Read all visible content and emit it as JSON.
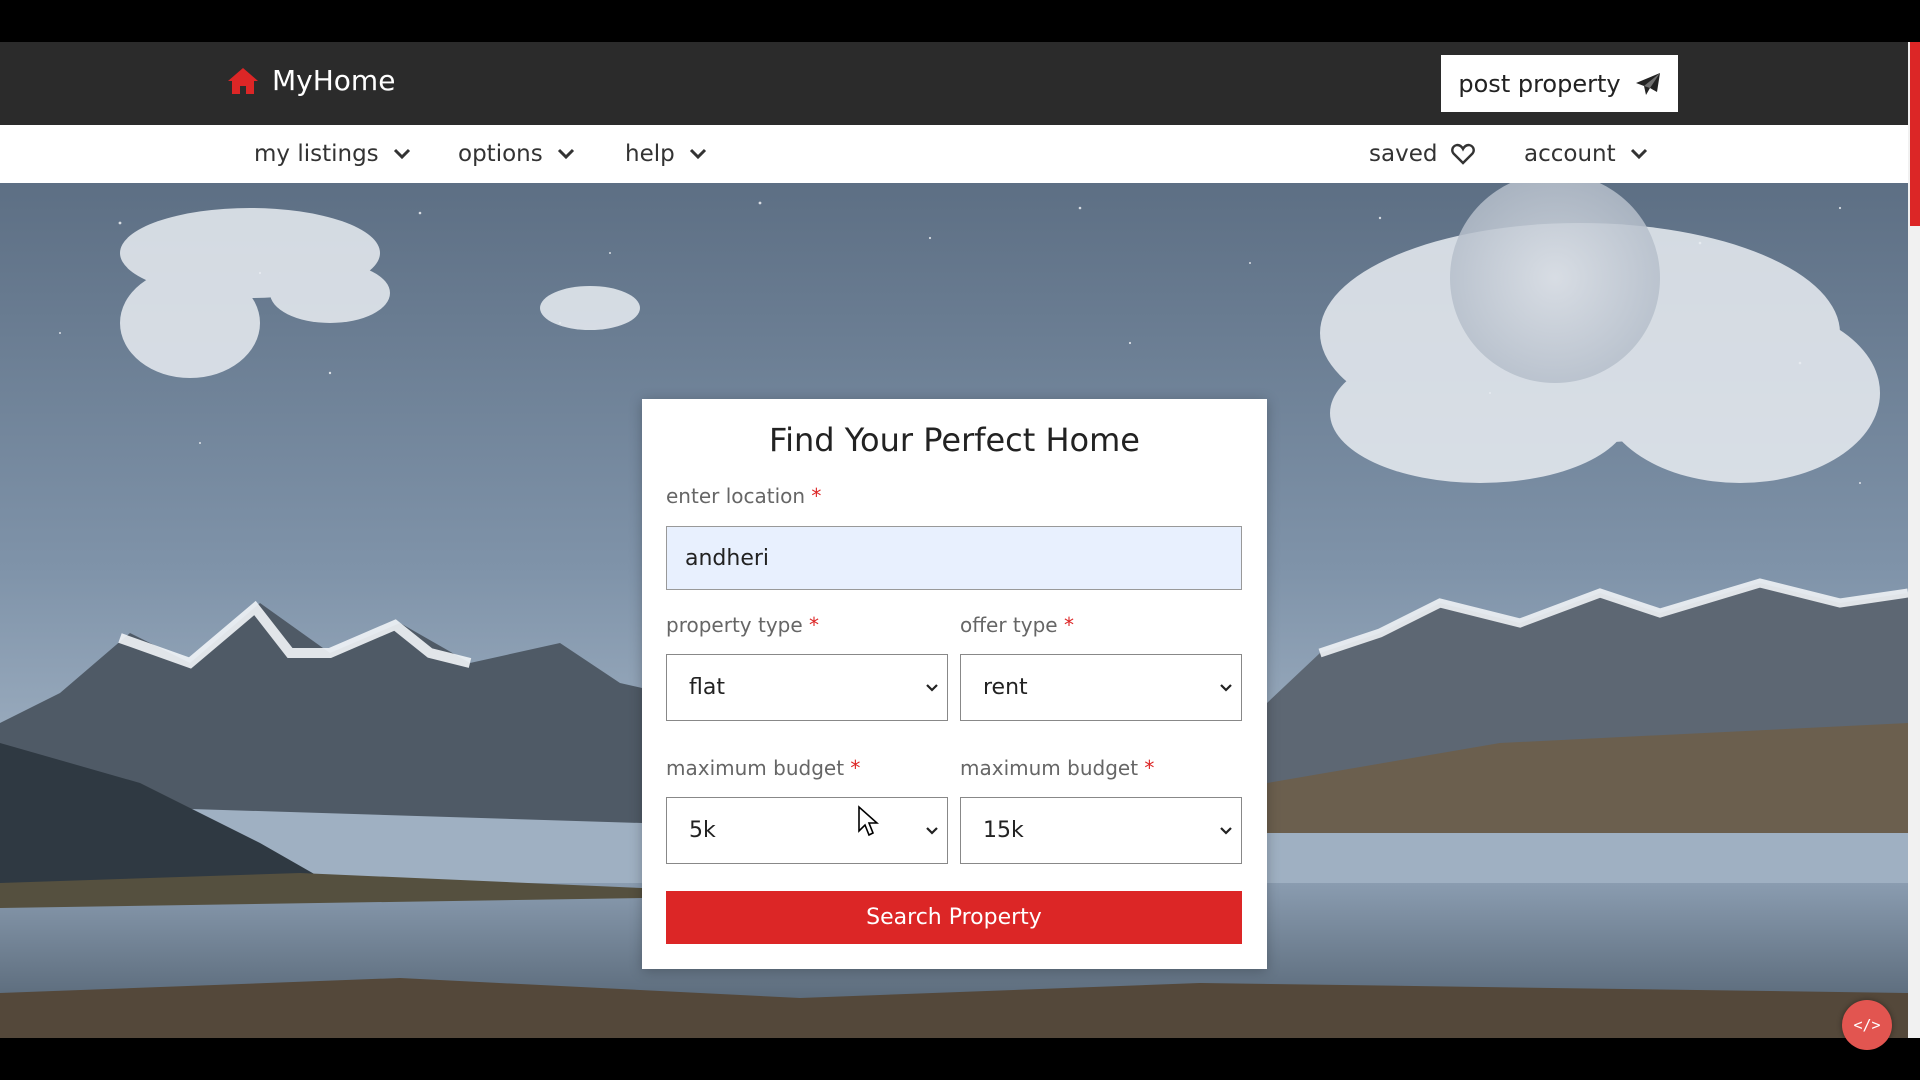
{
  "brand": {
    "name": "MyHome",
    "accent": "#dc2626",
    "icon": "house-icon"
  },
  "header": {
    "post_property": "post property",
    "post_icon": "paper-plane-icon"
  },
  "nav": {
    "my_listings": "my listings",
    "options": "options",
    "help": "help",
    "saved": "saved",
    "account": "account"
  },
  "form": {
    "title": "Find Your Perfect Home",
    "location_label": "enter location",
    "location_value": "andheri",
    "property_type_label": "property type",
    "property_type_value": "flat",
    "offer_type_label": "offer type",
    "offer_type_value": "rent",
    "min_budget_label": "maximum budget",
    "min_budget_value": "5k",
    "max_budget_label": "maximum budget",
    "max_budget_value": "15k",
    "required_mark": "*",
    "search_label": "Search Property"
  },
  "dev_badge": "</>"
}
